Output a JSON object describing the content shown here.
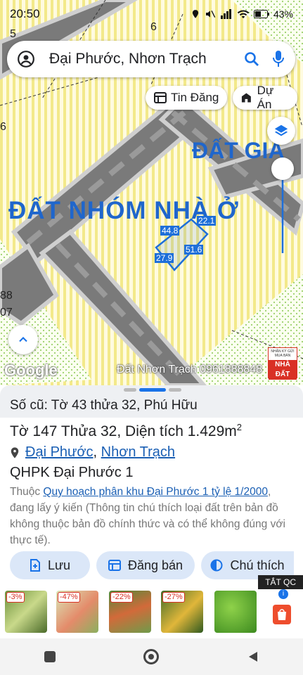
{
  "status": {
    "time": "20:50",
    "battery": "43%"
  },
  "search": {
    "query": "Đại Phước, Nhơn Trạch"
  },
  "chips": {
    "tin_dang": "Tin Đăng",
    "du_an": "Dự Án"
  },
  "map": {
    "label_main": "ĐẤT NHÓM NHÀ Ở",
    "label_right": "ĐẤT GIÁ",
    "edges": [
      "44.8",
      "22.1",
      "27.9",
      "51.6"
    ],
    "google": "Google",
    "watermark": "Đất Nhơn Trạch 0961888848",
    "badge_small": "NHẬN KÝ GỬI MUA BÁN",
    "badge_big": "NHÀ ĐẤT",
    "corner_labels": [
      "6",
      "88",
      "07",
      "5",
      "6"
    ]
  },
  "sheet": {
    "old": "Số cũ: Tờ 43 thửa 32, Phú Hữu",
    "parcel": "Tờ 147 Thửa 32, Diện tích 1.429m",
    "parcel_sup": "2",
    "ward": "Đại Phước",
    "district": "Nhơn Trạch",
    "comma": ",",
    "zone": "QHPK Đại Phước 1",
    "note_prefix": "Thuộc ",
    "note_link": "Quy hoạch phân khu Đại Phước 1 tỷ lệ 1/2000",
    "note_suffix": ", đang lấy ý kiến (Thông tin chú thích loại đất trên bản đồ không thuộc bản đồ chính thức và có thể không đúng với thực tế).",
    "btn_save": "Lưu",
    "btn_post": "Đăng bán",
    "btn_note": "Chú thích"
  },
  "ads": {
    "close": "TẮT QC",
    "discounts": [
      "-3%",
      "-47%",
      "-22%",
      "-27%"
    ]
  },
  "colors": {
    "accent": "#1a73e8",
    "plot": "#1e6fd9",
    "zone_text": "#1f66cc"
  }
}
